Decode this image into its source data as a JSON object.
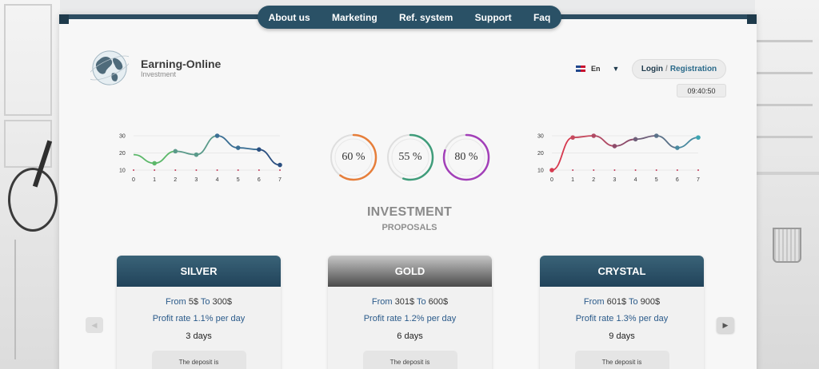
{
  "nav": {
    "items": [
      "About us",
      "Marketing",
      "Ref. system",
      "Support",
      "Faq"
    ]
  },
  "brand": {
    "title": "Earning-Online",
    "subtitle": "Investment"
  },
  "language": {
    "current": "En"
  },
  "auth": {
    "login_label": "Login",
    "separator": "/",
    "register_label": "Registration"
  },
  "clock": {
    "time": "09:40:50"
  },
  "rings": [
    {
      "value": "60 %",
      "color": "#e67e3a",
      "percent": 60
    },
    {
      "value": "55 %",
      "color": "#3f9c7a",
      "percent": 55
    },
    {
      "value": "80 %",
      "color": "#a23fb8",
      "percent": 80
    }
  ],
  "chart_data": [
    {
      "type": "line",
      "x": [
        0,
        1,
        2,
        3,
        4,
        5,
        6,
        7
      ],
      "ylim": [
        10,
        30
      ],
      "yticks": [
        10,
        20,
        30
      ],
      "series": [
        {
          "values": [
            19,
            14,
            21,
            19,
            30,
            23,
            22,
            13
          ],
          "colors": [
            "#5cb86a",
            "#5cb86a",
            "#5a9a8a",
            "#5a9a8a",
            "#3b6f94",
            "#3b6f94",
            "#2a4f80",
            "#2a4f80"
          ]
        }
      ]
    },
    {
      "type": "line",
      "x": [
        0,
        1,
        2,
        3,
        4,
        5,
        6,
        7
      ],
      "ylim": [
        10,
        30
      ],
      "yticks": [
        10,
        20,
        30
      ],
      "series": [
        {
          "values": [
            10,
            29,
            30,
            24,
            28,
            30,
            23,
            29
          ],
          "colors": [
            "#d6394f",
            "#c64a5e",
            "#b04a64",
            "#8d4b6a",
            "#6f5f7a",
            "#5b7289",
            "#4a8aa0",
            "#3ba5b2"
          ]
        }
      ]
    }
  ],
  "section": {
    "title": "INVESTMENT",
    "subtitle": "PROPOSALS"
  },
  "plans": [
    {
      "name": "SILVER",
      "from_word": "From",
      "from": "5$",
      "to_word": "To",
      "to": "300$",
      "rate": "Profit rate 1.1% per day",
      "days": "3 days",
      "note": "The deposit is"
    },
    {
      "name": "GOLD",
      "from_word": "From",
      "from": "301$",
      "to_word": "To",
      "to": "600$",
      "rate": "Profit rate 1.2% per day",
      "days": "6 days",
      "note": "The deposit is"
    },
    {
      "name": "CRYSTAL",
      "from_word": "From",
      "from": "601$",
      "to_word": "To",
      "to": "900$",
      "rate": "Profit rate 1.3% per day",
      "days": "9 days",
      "note": "The deposit is"
    }
  ],
  "carousel": {
    "prev_icon": "caret-left-icon",
    "next_icon": "caret-right-icon"
  }
}
